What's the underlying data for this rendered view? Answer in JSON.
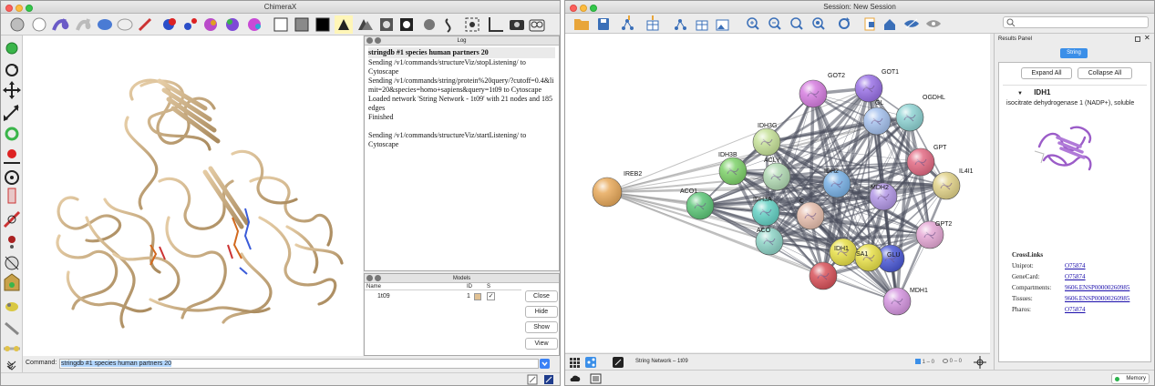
{
  "chimerax": {
    "title": "ChimeraX",
    "log": {
      "title": "Log",
      "header": "stringdb #1 species human partners 20",
      "lines": [
        "Sending /v1/commands/structureViz/stopListening/ to Cytoscape",
        "Sending /v1/commands/string/protein%20query/?cutoff=0.4&limit=20&species=homo+sapiens&query=1t09 to Cytoscape",
        "Loaded network 'String Network - 1t09' with 21 nodes and 185 edges",
        "Finished",
        "",
        "Sending /v1/commands/structureViz/startListening/ to Cytoscape"
      ]
    },
    "models": {
      "title": "Models",
      "columns": [
        "Name",
        "ID",
        "S"
      ],
      "rows": [
        {
          "name": "1t09",
          "id": "1",
          "color": "#e1c193",
          "shown": "✓"
        }
      ],
      "buttons": [
        "Close",
        "Hide",
        "Show",
        "View"
      ]
    },
    "command": {
      "label": "Command:",
      "value": "stringdb #1 species human partners 20"
    }
  },
  "cytoscape": {
    "title": "Session: New Session",
    "network_title": "String Network – 1t09",
    "status": {
      "selected": "1 – 0",
      "hidden": "0 – 0"
    },
    "memory": "Memory",
    "results": {
      "title": "Results Panel",
      "tab": "String",
      "expand": "Expand All",
      "collapse": "Collapse All",
      "protein": "IDH1",
      "description": "isocitrate dehydrogenase 1 (NADP+), soluble",
      "crosslinks_title": "CrossLinks",
      "links": [
        {
          "label": "Uniprot:",
          "value": "O75874"
        },
        {
          "label": "GeneCard:",
          "value": "O75874"
        },
        {
          "label": "Compartments:",
          "value": "9606.ENSP00000260985"
        },
        {
          "label": "Tissues:",
          "value": "9606.ENSP00000260985"
        },
        {
          "label": "Pharos:",
          "value": "O75874"
        }
      ]
    },
    "nodes": [
      {
        "label": "IREB2",
        "color": "#e8aa5c"
      },
      {
        "label": "GOT2",
        "color": "#d67ee0"
      },
      {
        "label": "GOT1",
        "color": "#9a72e6"
      },
      {
        "label": "OGDHL",
        "color": "#8fd3d3"
      },
      {
        "label": "GL",
        "color": "#a6c2ee"
      },
      {
        "label": "GPT",
        "color": "#e36b84"
      },
      {
        "label": "IL4I1",
        "color": "#e2d38a"
      },
      {
        "label": "IDH3G",
        "color": "#c7e29a"
      },
      {
        "label": "IDH3B",
        "color": "#7fd26b"
      },
      {
        "label": "ACLY",
        "color": "#b2dab4"
      },
      {
        "label": "IDH2",
        "color": "#7ab2e6"
      },
      {
        "label": "MDH2",
        "color": "#b398e6"
      },
      {
        "label": "ACO1",
        "color": "#5ec779"
      },
      {
        "label": "IDH3A",
        "color": "#66d2c5"
      },
      {
        "label": "C",
        "color": "#e7bfae"
      },
      {
        "label": "ACO",
        "color": "#8fd4c7"
      },
      {
        "label": "GPT2",
        "color": "#e6a9d6"
      },
      {
        "label": "IDH1",
        "color": "#e8e04a"
      },
      {
        "label": "GLU",
        "color": "#4c5ad6"
      },
      {
        "label": "SA1",
        "color": "#e8e04a"
      },
      {
        "label": "MDH1",
        "color": "#d596e0"
      },
      {
        "label": "",
        "color": "#d9535b"
      }
    ]
  },
  "colors": {
    "protein": "#d2b48c",
    "accent": "#3b8fe8"
  }
}
